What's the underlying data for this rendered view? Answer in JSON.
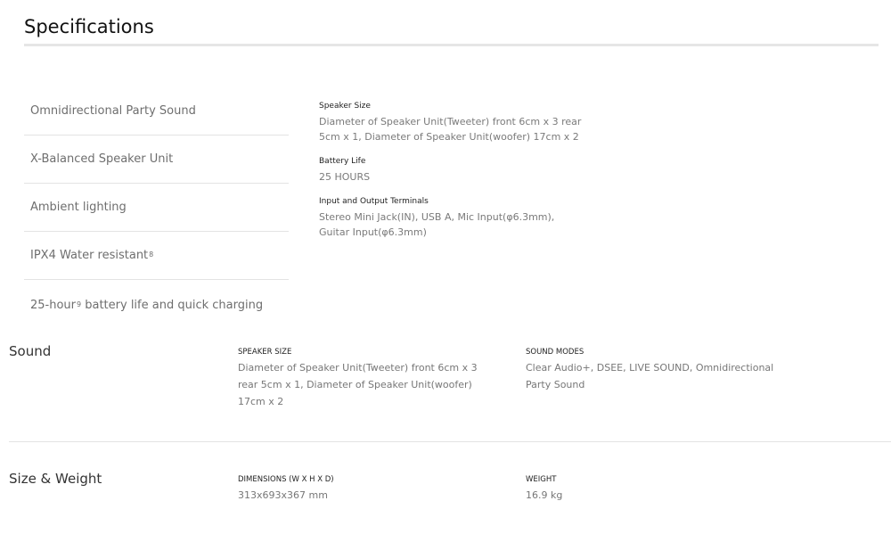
{
  "page": {
    "title": "Specifications"
  },
  "features": [
    {
      "label": "Omnidirectional Party Sound",
      "sup": ""
    },
    {
      "label": "X-Balanced Speaker Unit",
      "sup": ""
    },
    {
      "label": "Ambient lighting",
      "sup": ""
    },
    {
      "label": "IPX4 Water resistant",
      "sup": "8"
    },
    {
      "label_pre": "25-hour",
      "sup": "9",
      "label_post": " battery life and quick charging"
    }
  ],
  "details": [
    {
      "label": "Speaker Size",
      "value": "Diameter of Speaker Unit(Tweeter) front 6cm x 3 rear 5cm x 1, Diameter of Speaker Unit(woofer) 17cm x 2"
    },
    {
      "label": "Battery Life",
      "value": "25 HOURS"
    },
    {
      "label": "Input and Output Terminals",
      "value": "Stereo Mini Jack(IN), USB A, Mic Input(φ6.3mm), Guitar Input(φ6.3mm)"
    }
  ],
  "sections": {
    "sound": {
      "title": "Sound",
      "specs": [
        {
          "label": "SPEAKER SIZE",
          "value": "Diameter of Speaker Unit(Tweeter) front 6cm x 3 rear 5cm x 1, Diameter of Speaker Unit(woofer) 17cm x 2"
        },
        {
          "label": "SOUND MODES",
          "value": "Clear Audio+, DSEE, LIVE SOUND, Omnidirectional Party Sound"
        }
      ]
    },
    "size_weight": {
      "title": "Size & Weight",
      "specs": [
        {
          "label": "DIMENSIONS (W X H X D)",
          "value": "313x693x367 mm"
        },
        {
          "label": "WEIGHT",
          "value": "16.9 kg"
        }
      ]
    }
  }
}
